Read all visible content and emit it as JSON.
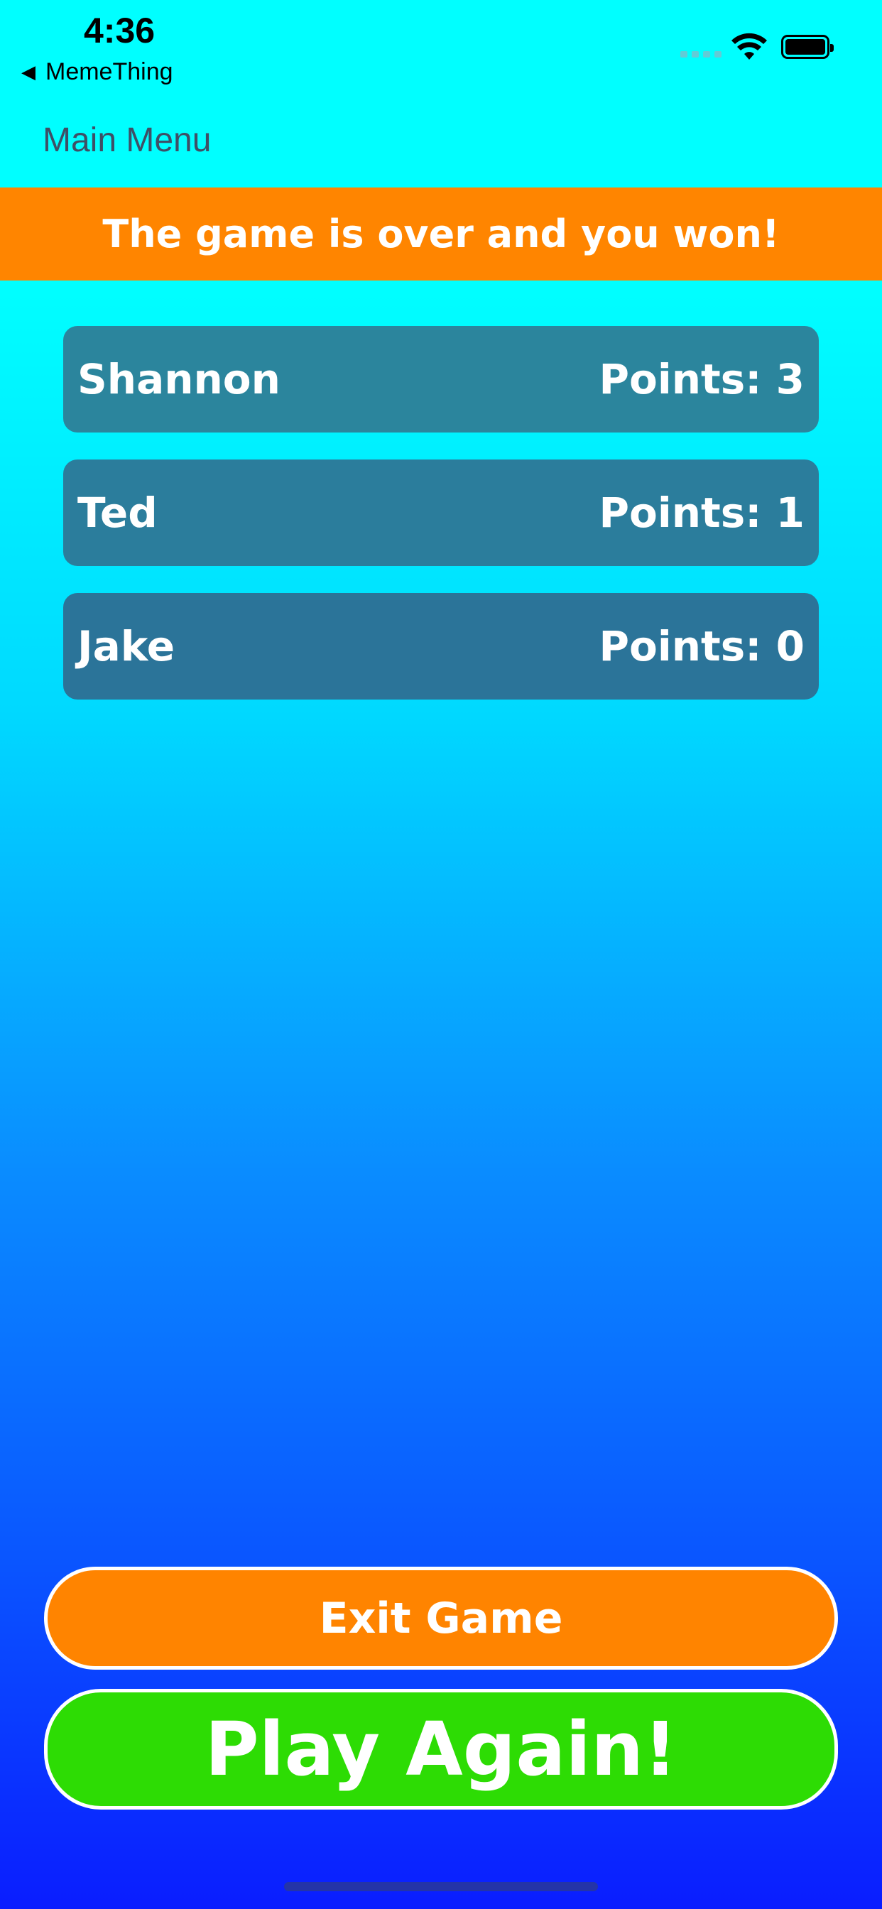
{
  "status_bar": {
    "time": "4:36",
    "back_app": "MemeThing",
    "back_glyph": "◀"
  },
  "nav": {
    "back_label": "Main Menu"
  },
  "banner": {
    "text": "The game is over and you won!"
  },
  "players": [
    {
      "name": "Shannon",
      "points": "Points: 3"
    },
    {
      "name": "Ted",
      "points": "Points: 1"
    },
    {
      "name": "Jake",
      "points": "Points: 0"
    }
  ],
  "buttons": {
    "exit_label": "Exit Game",
    "play_label": "Play Again!"
  },
  "colors": {
    "banner": "#ff8500",
    "exit_button": "#ff8400",
    "play_button": "#2ddc04",
    "row": "#2b7d9c",
    "top_background": "#00ffff",
    "bottom_background": "#0a1dff"
  },
  "icons": [
    "signal-icon",
    "wifi-icon",
    "battery-icon",
    "back-triangle-icon"
  ]
}
